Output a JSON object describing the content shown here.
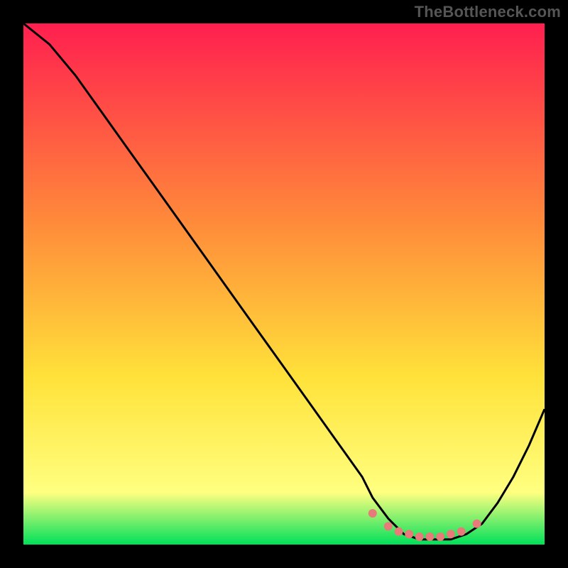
{
  "watermark": "TheBottleneck.com",
  "colors": {
    "bg": "#000000",
    "grad_top": "#ff1f4f",
    "grad_mid1": "#ff8a3a",
    "grad_mid2": "#ffe23a",
    "grad_mid3": "#ffff80",
    "grad_bottom": "#00e05a",
    "curve": "#000000",
    "dots": "#e87b7a"
  },
  "chart_data": {
    "type": "line",
    "title": "",
    "xlabel": "",
    "ylabel": "",
    "x": [
      0.0,
      0.05,
      0.1,
      0.15,
      0.2,
      0.25,
      0.3,
      0.35,
      0.4,
      0.45,
      0.5,
      0.55,
      0.6,
      0.65,
      0.67,
      0.7,
      0.73,
      0.76,
      0.79,
      0.82,
      0.85,
      0.88,
      0.91,
      0.94,
      0.97,
      1.0
    ],
    "values": [
      100,
      96,
      90,
      83,
      76,
      69,
      62,
      55,
      48,
      41,
      34,
      27,
      20,
      13,
      9,
      5,
      2,
      1,
      1,
      1,
      2,
      4,
      8,
      13,
      19,
      26
    ],
    "xlim": [
      0,
      1
    ],
    "ylim": [
      0,
      100
    ],
    "markers": {
      "x": [
        0.67,
        0.7,
        0.72,
        0.74,
        0.76,
        0.78,
        0.8,
        0.82,
        0.84,
        0.87
      ],
      "y": [
        6.0,
        3.5,
        2.5,
        2.0,
        1.5,
        1.5,
        1.5,
        2.0,
        2.5,
        4.0
      ]
    }
  }
}
